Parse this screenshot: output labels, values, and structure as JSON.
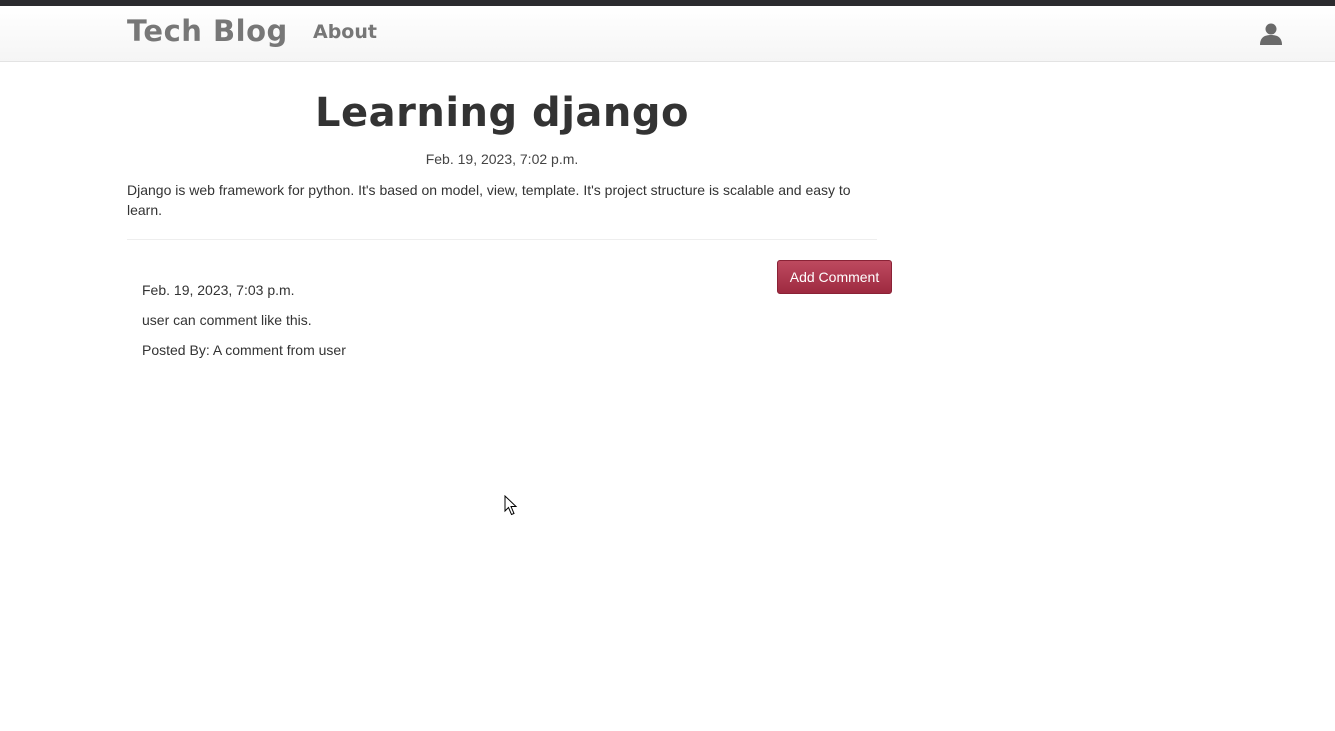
{
  "navbar": {
    "brand": "Tech Blog",
    "about_label": "About",
    "user_icon": "user-icon"
  },
  "post": {
    "title": "Learning django",
    "date": "Feb. 19, 2023, 7:02 p.m.",
    "body": "Django is web framework for python. It's based on model, view, template. It's project structure is scalable and easy to learn."
  },
  "actions": {
    "add_comment_label": "Add Comment"
  },
  "comments": [
    {
      "date": "Feb. 19, 2023, 7:03 p.m.",
      "text": "user can comment like this.",
      "posted_by": "Posted By: A comment from user"
    }
  ],
  "colors": {
    "top_stripe": "#2b2b2e",
    "nav_text": "#777777",
    "button": "#ad374e"
  }
}
